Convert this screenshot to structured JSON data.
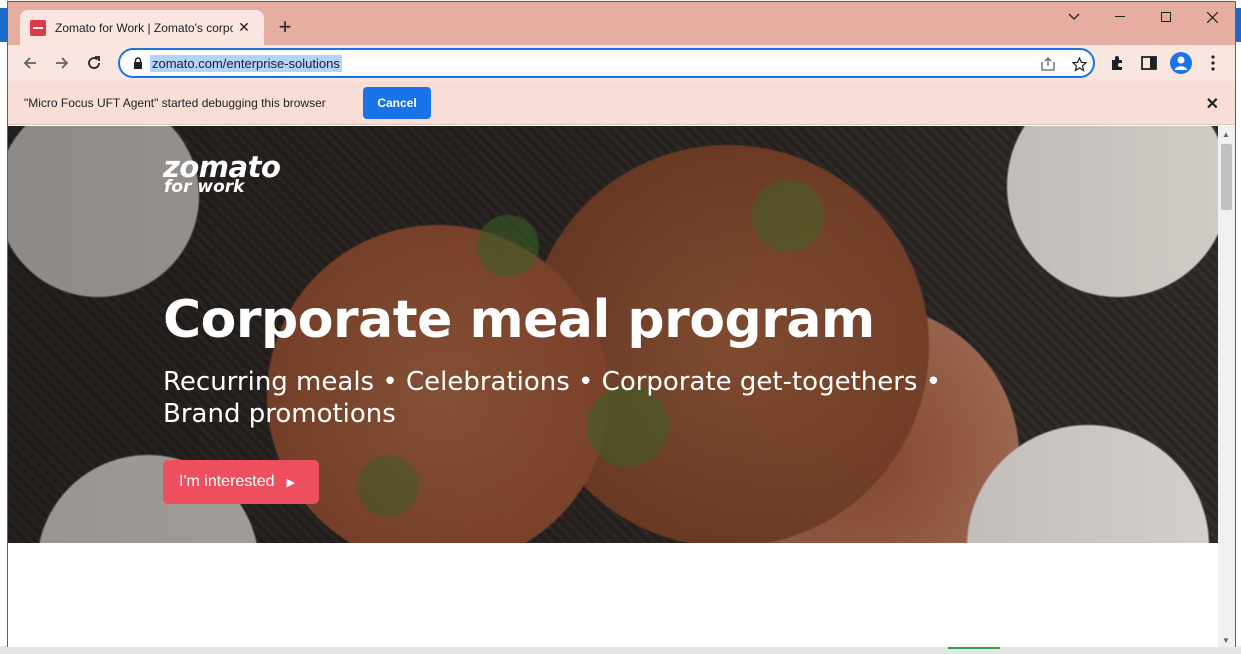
{
  "browser": {
    "tab": {
      "title": "Zomato for Work | Zomato's corporate meal program",
      "favicon": "zomato-favicon"
    },
    "new_tab_label": "+",
    "window_controls": {
      "tab_search": "⌄",
      "minimize": "—",
      "maximize": "☐",
      "close": "✕"
    },
    "nav": {
      "back": "←",
      "forward": "→",
      "reload": "↻"
    },
    "address": {
      "url": "zomato.com/enterprise-solutions"
    },
    "icons": [
      "lock-icon",
      "share-icon",
      "bookmark-star-icon",
      "extensions-icon",
      "side-panel-icon",
      "profile-avatar-icon",
      "menu-icon"
    ]
  },
  "infobar": {
    "message": "\"Micro Focus UFT Agent\" started debugging this browser",
    "cancel_label": "Cancel",
    "close": "✕"
  },
  "hero": {
    "logo_line1": "zomato",
    "logo_line2": "for work",
    "headline": "Corporate meal program",
    "subline": "Recurring meals • Celebrations • Corporate get-togethers • Brand promotions",
    "cta_label": "I'm interested",
    "cta_arrow": "▶",
    "cta_color": "#ed4f5e"
  },
  "scrollbar": {
    "up": "▲",
    "down": "▼"
  },
  "colors": {
    "titlebar": "#e6aea0",
    "toolbar": "#f9e6e0",
    "accent": "#1a73e8"
  }
}
